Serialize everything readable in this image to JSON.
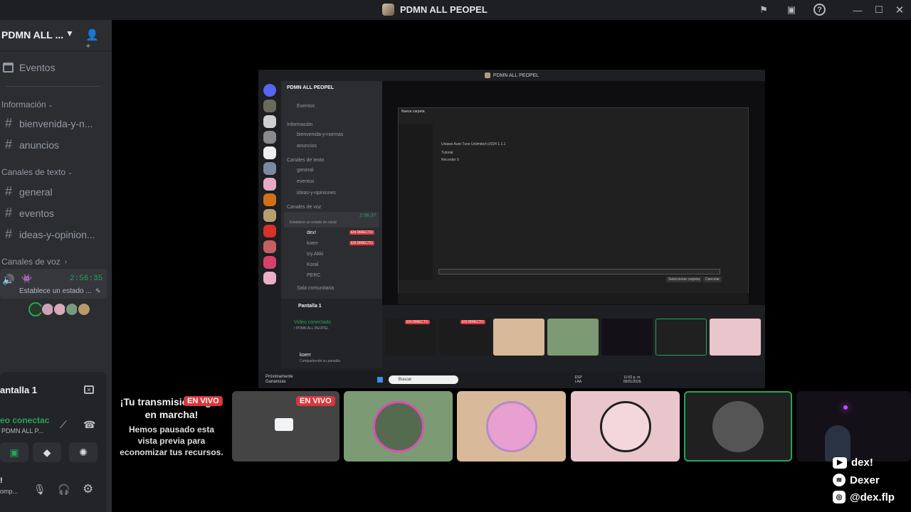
{
  "window": {
    "title": "PDMN ALL PEOPEL",
    "icons": [
      "flag-icon",
      "inbox-icon",
      "help-icon",
      "minimize-icon",
      "maximize-icon",
      "close-icon"
    ]
  },
  "sidebar": {
    "guild_name": "PDMN ALL ...",
    "events_label": "Eventos",
    "categories": {
      "info": "Información",
      "text": "Canales de texto",
      "voice": "Canales de voz"
    },
    "info_channels": [
      "bienvenida-y-n...",
      "anuncios"
    ],
    "text_channels": [
      "general",
      "eventos",
      "ideas-y-opinion..."
    ],
    "voice_channel": {
      "time": "2:56:35",
      "status": "Establece un estado ..."
    }
  },
  "panel": {
    "title": "antalla 1",
    "video_connected": "eo conectac",
    "video_sub": "PDMN ALL P...",
    "user_name": "!",
    "user_sub": "omp..."
  },
  "shared_screen": {
    "title": "PDMN ALL PEOPEL",
    "guild_name": "PDMN ALL PEOPEL",
    "events": "Eventos",
    "info_cat": "Información",
    "info_ch": [
      "bienvenida-y-normas",
      "anuncios"
    ],
    "text_cat": "Canales de texto",
    "text_ch": [
      "general",
      "eventos",
      "ideas-y-opiniones"
    ],
    "voice_cat": "Canales de voz",
    "voice_time": "2:56:37",
    "voice_status": "Establece un estado de canal",
    "voice_users": [
      "dex!",
      "koerr",
      "icy.Akki",
      "Koral",
      "PERC"
    ],
    "live": "EN DIRECTO",
    "community": "Sala comunitaria",
    "screen_panel": "Pantalla 1",
    "video_connected": "Video conectado",
    "video_sub": "/ PDMN ALL PEOPEL",
    "me": "koerr",
    "me_sub": "Compartiendo su pantalla",
    "dialog_title": "Nueva carpeta",
    "file_rows": [
      "Unlaws Auto-Tune Unlimited v2024 1.1.1",
      "Tutorial",
      "Recorder 9"
    ],
    "dialog_save": "Seleccionar carpeta",
    "dialog_cancel": "Cancelar",
    "taskbar_left": "Próximamente",
    "taskbar_left_sub": "Ganancias",
    "search": "Buscar",
    "lang": "ESP",
    "lang2": "LAA",
    "clock": "11:02 p. m.",
    "date": "09/01/2026"
  },
  "notice": {
    "title": "¡Tu transmisión sigue en marcha!",
    "body": "Hemos pausado esta vista previa para economizar tus recursos.",
    "live": "EN VIVO"
  },
  "tile_live": "EN VIVO",
  "social": {
    "youtube": "dex!",
    "spotify": "Dexer",
    "instagram": "@dex.flp"
  },
  "colors": {
    "accent_green": "#23a55a",
    "live_red": "#da373c",
    "tile_green": "#7c9a73",
    "tile_tan": "#d8b99a",
    "tile_pink": "#e8c6cb"
  }
}
